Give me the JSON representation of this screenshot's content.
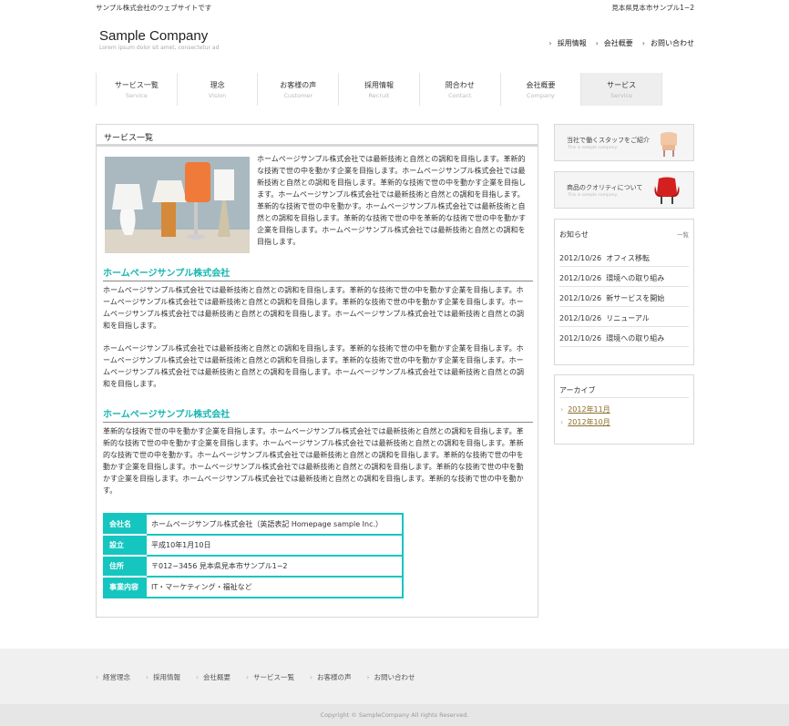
{
  "header": {
    "tagline": "サンプル株式会社のウェブサイトです",
    "address": "見本県見本市サンプル1−2",
    "logo": "Sample Company",
    "logo_sub": "Lorem ipsum dolor sit amet, consectetur ad",
    "links": [
      "採用情報",
      "会社概要",
      "お問い合わせ"
    ]
  },
  "gnav": [
    {
      "jp": "サービス一覧",
      "en": "Service"
    },
    {
      "jp": "理念",
      "en": "Vision"
    },
    {
      "jp": "お客様の声",
      "en": "Customer"
    },
    {
      "jp": "採用情報",
      "en": "Recruit"
    },
    {
      "jp": "問合わせ",
      "en": "Contact"
    },
    {
      "jp": "会社概要",
      "en": "Company"
    },
    {
      "jp": "サービス",
      "en": "Service"
    }
  ],
  "main": {
    "title": "サービス一覧",
    "intro": "ホームページサンプル株式会社では最新技術と自然との調和を目指します。革新的な技術で世の中を動かす企業を目指します。ホームページサンプル株式会社では最新技術と自然との調和を目指します。革新的な技術で世の中を動かす企業を目指します。ホームページサンプル株式会社では最新技術と自然との調和を目指します。革新的な技術で世の中を動かす。ホームページサンプル株式会社では最新技術と自然との調和を目指します。革新的な技術で世の中を革新的な技術で世の中を動かす企業を目指します。ホームページサンプル株式会社では最新技術と自然との調和を目指します。",
    "section1_heading": "ホームページサンプル株式会社",
    "section1_p1": "ホームページサンプル株式会社では最新技術と自然との調和を目指します。革新的な技術で世の中を動かす企業を目指します。ホームページサンプル株式会社では最新技術と自然との調和を目指します。革新的な技術で世の中を動かす企業を目指します。ホームページサンプル株式会社では最新技術と自然との調和を目指します。ホームページサンプル株式会社では最新技術と自然との調和を目指します。",
    "section1_p2": "ホームページサンプル株式会社では最新技術と自然との調和を目指します。革新的な技術で世の中を動かす企業を目指します。ホームページサンプル株式会社では最新技術と自然との調和を目指します。革新的な技術で世の中を動かす企業を目指します。ホームページサンプル株式会社では最新技術と自然との調和を目指します。ホームページサンプル株式会社では最新技術と自然との調和を目指します。",
    "section2_heading": "ホームページサンプル株式会社",
    "section2_p1": "革新的な技術で世の中を動かす企業を目指します。ホームページサンプル株式会社では最新技術と自然との調和を目指します。革新的な技術で世の中を動かす企業を目指します。ホームページサンプル株式会社では最新技術と自然との調和を目指します。革新的な技術で世の中を動かす。ホームページサンプル株式会社では最新技術と自然との調和を目指します。革新的な技術で世の中を動かす企業を目指します。ホームページサンプル株式会社では最新技術と自然との調和を目指します。革新的な技術で世の中を動かす企業を目指します。ホームページサンプル株式会社では最新技術と自然との調和を目指します。革新的な技術で世の中を動かす。",
    "info": [
      {
        "k": "会社名",
        "v": "ホームページサンプル株式会社（英語表記 Homepage sample Inc.）"
      },
      {
        "k": "設立",
        "v": "平成10年1月10日"
      },
      {
        "k": "住所",
        "v": "〒012−3456 見本県見本市サンプル1−2"
      },
      {
        "k": "事業内容",
        "v": "IT・マーケティング・福祉など"
      }
    ]
  },
  "sidebar": {
    "banner1": {
      "title": "当社で働くスタッフをご紹介",
      "sub": "This is sample company."
    },
    "banner2": {
      "title": "商品のクオリティについて",
      "sub": "This is sample company."
    },
    "news_title": "お知らせ",
    "news_more": "一覧",
    "news": [
      {
        "date": "2012/10/26",
        "text": "オフィス移転"
      },
      {
        "date": "2012/10/26",
        "text": "環境への取り組み"
      },
      {
        "date": "2012/10/26",
        "text": "新サービスを開始"
      },
      {
        "date": "2012/10/26",
        "text": "リニューアル"
      },
      {
        "date": "2012/10/26",
        "text": "環境への取り組み"
      }
    ],
    "archive_title": "アーカイブ",
    "archive": [
      "2012年11月",
      "2012年10月"
    ]
  },
  "footer": {
    "links": [
      "経営理念",
      "採用情報",
      "会社概要",
      "サービス一覧",
      "お客様の声",
      "お問い合わせ"
    ],
    "copyright": "Copyright © SampleCompany All rights Reserved."
  },
  "colors": {
    "accent": "#15c6c0",
    "heading": "#15b6b3"
  }
}
